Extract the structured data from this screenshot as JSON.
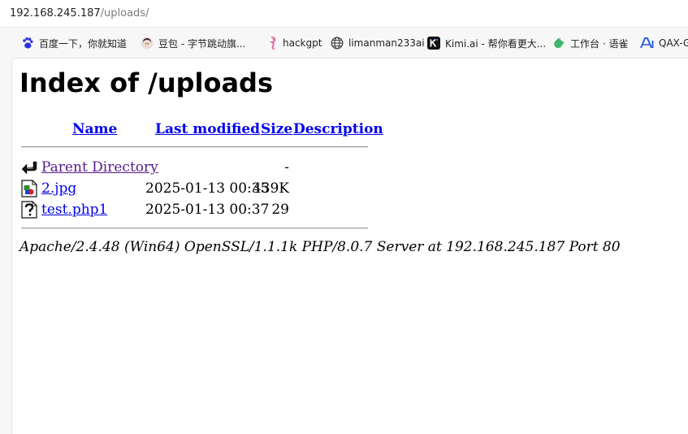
{
  "browser": {
    "url_host": "192.168.245.187",
    "url_path": "/uploads/",
    "bookmarks": [
      {
        "label": "百度一下，你就知道",
        "icon": "baidu-paw-icon"
      },
      {
        "label": "豆包 - 字节跳动旗...",
        "icon": "doubao-avatar-icon"
      },
      {
        "label": "hackgpt",
        "icon": "pink-seahorse-icon"
      },
      {
        "label": "limanman233ai",
        "icon": "globe-icon"
      },
      {
        "label": "Kimi.ai - 帮你看更大...",
        "icon": "kimi-k-icon"
      },
      {
        "label": "工作台 · 语雀",
        "icon": "yuque-bird-icon"
      },
      {
        "label": "QAX-G",
        "icon": "ai-icon"
      }
    ]
  },
  "page": {
    "title": "Index of /uploads",
    "columns": {
      "name": "Name",
      "last_modified": "Last modified",
      "size": "Size",
      "description": "Description"
    },
    "rows": [
      {
        "name": "Parent Directory",
        "modified": "",
        "size": "-",
        "icon": "back-arrow-icon",
        "visited": true
      },
      {
        "name": "2.jpg",
        "modified": "2025-01-13 00:35",
        "size": "439K",
        "icon": "image-file-icon",
        "visited": false
      },
      {
        "name": "test.php1",
        "modified": "2025-01-13 00:37",
        "size": "29",
        "icon": "unknown-file-icon",
        "visited": false
      }
    ],
    "server_signature": "Apache/2.4.48 (Win64) OpenSSL/1.1.1k PHP/8.0.7 Server at 192.168.245.187 Port 80"
  }
}
